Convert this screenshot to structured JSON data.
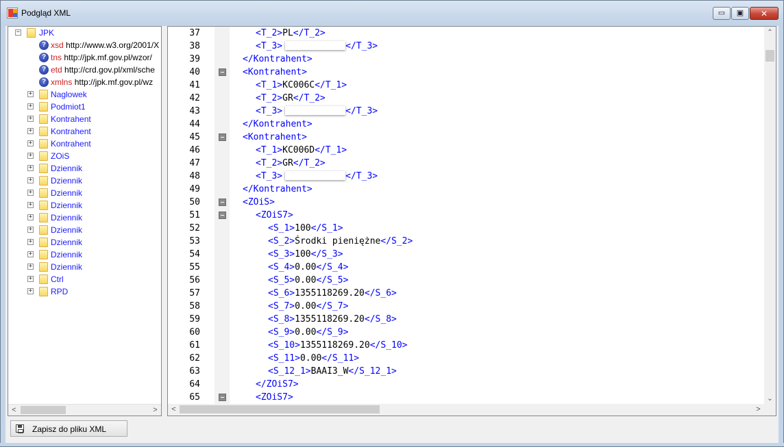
{
  "window": {
    "title": "Podgląd XML",
    "minimize_glyph": "▭",
    "maximize_glyph": "▣",
    "close_glyph": "✕"
  },
  "tree": {
    "root": {
      "label": "JPK",
      "expander": "−",
      "icon": "folder-icon"
    },
    "namespaces": [
      {
        "prefix": "xsd",
        "url": "http://www.w3.org/2001/X",
        "icon": "question-icon"
      },
      {
        "prefix": "tns",
        "url": "http://jpk.mf.gov.pl/wzor/",
        "icon": "question-icon"
      },
      {
        "prefix": "etd",
        "url": "http://crd.gov.pl/xml/sche",
        "icon": "question-icon"
      },
      {
        "prefix": "xmlns",
        "url": "http://jpk.mf.gov.pl/wz",
        "icon": "question-icon"
      }
    ],
    "nodes": [
      {
        "label": "Naglowek"
      },
      {
        "label": "Podmiot1"
      },
      {
        "label": "Kontrahent"
      },
      {
        "label": "Kontrahent"
      },
      {
        "label": "Kontrahent"
      },
      {
        "label": "ZOiS"
      },
      {
        "label": "Dziennik"
      },
      {
        "label": "Dziennik"
      },
      {
        "label": "Dziennik"
      },
      {
        "label": "Dziennik"
      },
      {
        "label": "Dziennik"
      },
      {
        "label": "Dziennik"
      },
      {
        "label": "Dziennik"
      },
      {
        "label": "Dziennik"
      },
      {
        "label": "Dziennik"
      },
      {
        "label": "Ctrl"
      },
      {
        "label": "RPD"
      }
    ],
    "node_expander": "+",
    "question_glyph": "?"
  },
  "code": {
    "lines": [
      {
        "num": "37",
        "indent": 2,
        "fold": false,
        "open": "<T_2>",
        "text": "PL",
        "close": "</T_2>",
        "redacted": false
      },
      {
        "num": "38",
        "indent": 2,
        "fold": false,
        "open": "<T_3>",
        "text": "",
        "close": "</T_3>",
        "redacted": true
      },
      {
        "num": "39",
        "indent": 1,
        "fold": false,
        "open": "",
        "text": "",
        "close": "</Kontrahent>",
        "redacted": false
      },
      {
        "num": "40",
        "indent": 1,
        "fold": true,
        "open": "<Kontrahent>",
        "text": "",
        "close": "",
        "redacted": false
      },
      {
        "num": "41",
        "indent": 2,
        "fold": false,
        "open": "<T_1>",
        "text": "KC006C",
        "close": "</T_1>",
        "redacted": false
      },
      {
        "num": "42",
        "indent": 2,
        "fold": false,
        "open": "<T_2>",
        "text": "GR",
        "close": "</T_2>",
        "redacted": false
      },
      {
        "num": "43",
        "indent": 2,
        "fold": false,
        "open": "<T_3>",
        "text": "",
        "close": "</T_3>",
        "redacted": true
      },
      {
        "num": "44",
        "indent": 1,
        "fold": false,
        "open": "",
        "text": "",
        "close": "</Kontrahent>",
        "redacted": false
      },
      {
        "num": "45",
        "indent": 1,
        "fold": true,
        "open": "<Kontrahent>",
        "text": "",
        "close": "",
        "redacted": false
      },
      {
        "num": "46",
        "indent": 2,
        "fold": false,
        "open": "<T_1>",
        "text": "KC006D",
        "close": "</T_1>",
        "redacted": false
      },
      {
        "num": "47",
        "indent": 2,
        "fold": false,
        "open": "<T_2>",
        "text": "GR",
        "close": "</T_2>",
        "redacted": false
      },
      {
        "num": "48",
        "indent": 2,
        "fold": false,
        "open": "<T_3>",
        "text": "",
        "close": "</T_3>",
        "redacted": true
      },
      {
        "num": "49",
        "indent": 1,
        "fold": false,
        "open": "",
        "text": "",
        "close": "</Kontrahent>",
        "redacted": false
      },
      {
        "num": "50",
        "indent": 1,
        "fold": true,
        "open": "<ZOiS>",
        "text": "",
        "close": "",
        "redacted": false
      },
      {
        "num": "51",
        "indent": 2,
        "fold": true,
        "open": "<ZOiS7>",
        "text": "",
        "close": "",
        "redacted": false
      },
      {
        "num": "52",
        "indent": 3,
        "fold": false,
        "open": "<S_1>",
        "text": "100",
        "close": "</S_1>",
        "redacted": false
      },
      {
        "num": "53",
        "indent": 3,
        "fold": false,
        "open": "<S_2>",
        "text": "Środki pieniężne",
        "close": "</S_2>",
        "redacted": false
      },
      {
        "num": "54",
        "indent": 3,
        "fold": false,
        "open": "<S_3>",
        "text": "100",
        "close": "</S_3>",
        "redacted": false
      },
      {
        "num": "55",
        "indent": 3,
        "fold": false,
        "open": "<S_4>",
        "text": "0.00",
        "close": "</S_4>",
        "redacted": false
      },
      {
        "num": "56",
        "indent": 3,
        "fold": false,
        "open": "<S_5>",
        "text": "0.00",
        "close": "</S_5>",
        "redacted": false
      },
      {
        "num": "57",
        "indent": 3,
        "fold": false,
        "open": "<S_6>",
        "text": "1355118269.20",
        "close": "</S_6>",
        "redacted": false
      },
      {
        "num": "58",
        "indent": 3,
        "fold": false,
        "open": "<S_7>",
        "text": "0.00",
        "close": "</S_7>",
        "redacted": false
      },
      {
        "num": "59",
        "indent": 3,
        "fold": false,
        "open": "<S_8>",
        "text": "1355118269.20",
        "close": "</S_8>",
        "redacted": false
      },
      {
        "num": "60",
        "indent": 3,
        "fold": false,
        "open": "<S_9>",
        "text": "0.00",
        "close": "</S_9>",
        "redacted": false
      },
      {
        "num": "61",
        "indent": 3,
        "fold": false,
        "open": "<S_10>",
        "text": "1355118269.20",
        "close": "</S_10>",
        "redacted": false
      },
      {
        "num": "62",
        "indent": 3,
        "fold": false,
        "open": "<S_11>",
        "text": "0.00",
        "close": "</S_11>",
        "redacted": false
      },
      {
        "num": "63",
        "indent": 3,
        "fold": false,
        "open": "<S_12_1>",
        "text": "BAAI3_W",
        "close": "</S_12_1>",
        "redacted": false
      },
      {
        "num": "64",
        "indent": 2,
        "fold": false,
        "open": "",
        "text": "",
        "close": "</ZOiS7>",
        "redacted": false
      },
      {
        "num": "65",
        "indent": 2,
        "fold": true,
        "open": "<ZOiS7>",
        "text": "",
        "close": "",
        "redacted": false
      }
    ]
  },
  "scroll": {
    "up_glyph": "⌃",
    "down_glyph": "⌄",
    "left_glyph": "<",
    "right_glyph": ">"
  },
  "footer": {
    "save_button_label": "Zapisz do pliku XML"
  },
  "colors": {
    "tag": "#0000ff",
    "tree_link": "#1a1aff",
    "ns_prefix": "#cc1f1f"
  }
}
